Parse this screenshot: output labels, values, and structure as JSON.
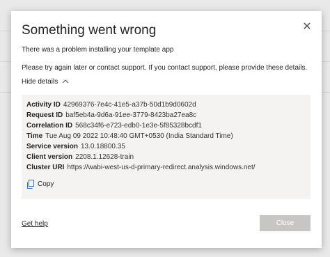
{
  "dialog": {
    "title": "Something went wrong",
    "message": "There was a problem installing your template app",
    "instructions": "Please try again later or contact support. If you contact support, please provide these details.",
    "toggle_label": "Hide details",
    "details": [
      {
        "label": "Activity ID",
        "value": "42969376-7e4c-41e5-a37b-50d1b9d0602d"
      },
      {
        "label": "Request ID",
        "value": "baf5eb4a-9d6a-91ee-3779-8423ba27ea8c"
      },
      {
        "label": "Correlation ID",
        "value": "568c34f6-e723-edb0-1e3e-5f85328bcdf1"
      },
      {
        "label": "Time",
        "value": "Tue Aug 09 2022 10:48:40 GMT+0530 (India Standard Time)"
      },
      {
        "label": "Service version",
        "value": "13.0.18800.35"
      },
      {
        "label": "Client version",
        "value": "2208.1.12628-train"
      },
      {
        "label": "Cluster URI",
        "value": "https://wabi-west-us-d-primary-redirect.analysis.windows.net/"
      }
    ],
    "copy_label": "Copy",
    "help_label": "Get help",
    "close_label": "Close",
    "close_icon": "✕"
  },
  "colors": {
    "details_bg": "#f4f3f2",
    "button_disabled": "#c8c6c4",
    "text": "#252423"
  }
}
